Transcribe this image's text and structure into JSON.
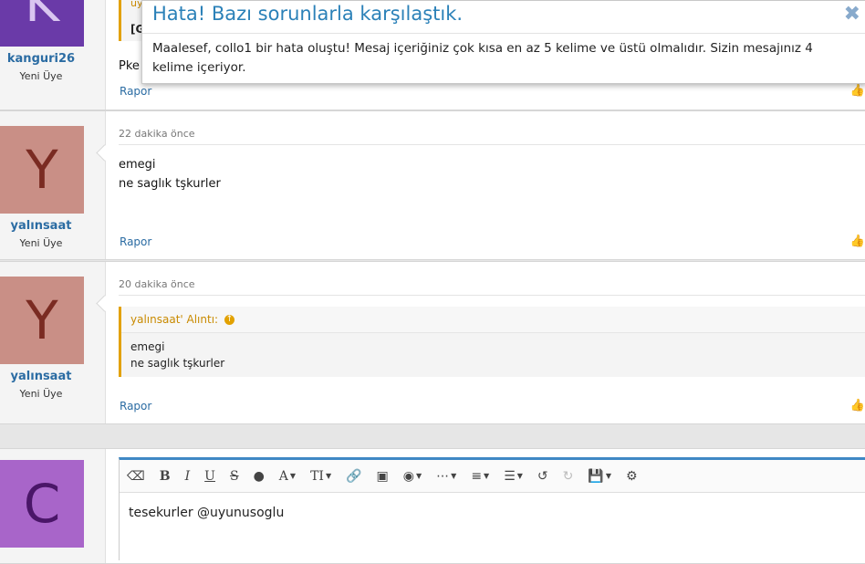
{
  "colors": {
    "accent": "#2b6ca3",
    "quote_border": "#e2a100",
    "notice_title": "#2b81b8"
  },
  "notice": {
    "title": "Hata! Bazı sorunlarla karşılaştık.",
    "message": "Maalesef, collo1 bir hata oluştu! Mesaj içeriğiniz çok kısa en az 5 kelime ve üstü olmalıdır. Sizin mesajınız 4 kelime içeriyor.",
    "close_icon": "close-icon"
  },
  "posts": [
    {
      "avatar_letter": "K",
      "username": "kanguri26",
      "role": "Yeni Üye",
      "quote_head_partial": "uy",
      "quote_line_partial": "[G",
      "message_partial": "Pke",
      "report": "Rapor"
    },
    {
      "avatar_letter": "Y",
      "username": "yalınsaat",
      "role": "Yeni Üye",
      "date": "22 dakika önce",
      "message_lines": [
        "emegi",
        "ne saglık tşkurler"
      ],
      "report": "Rapor"
    },
    {
      "avatar_letter": "Y",
      "username": "yalınsaat",
      "role": "Yeni Üye",
      "date": "20 dakika önce",
      "quote": {
        "head": "yalınsaat' Alıntı:",
        "lines": [
          "emegi",
          "ne saglık tşkurler"
        ]
      },
      "report": "Rapor"
    }
  ],
  "reply": {
    "avatar_letter": "C",
    "text": "tesekurler @uyunusoglu"
  },
  "toolbar": {
    "bold": "B",
    "italic": "I",
    "underline": "U",
    "strike": "S",
    "font_color": "A",
    "font_size": "TI"
  }
}
